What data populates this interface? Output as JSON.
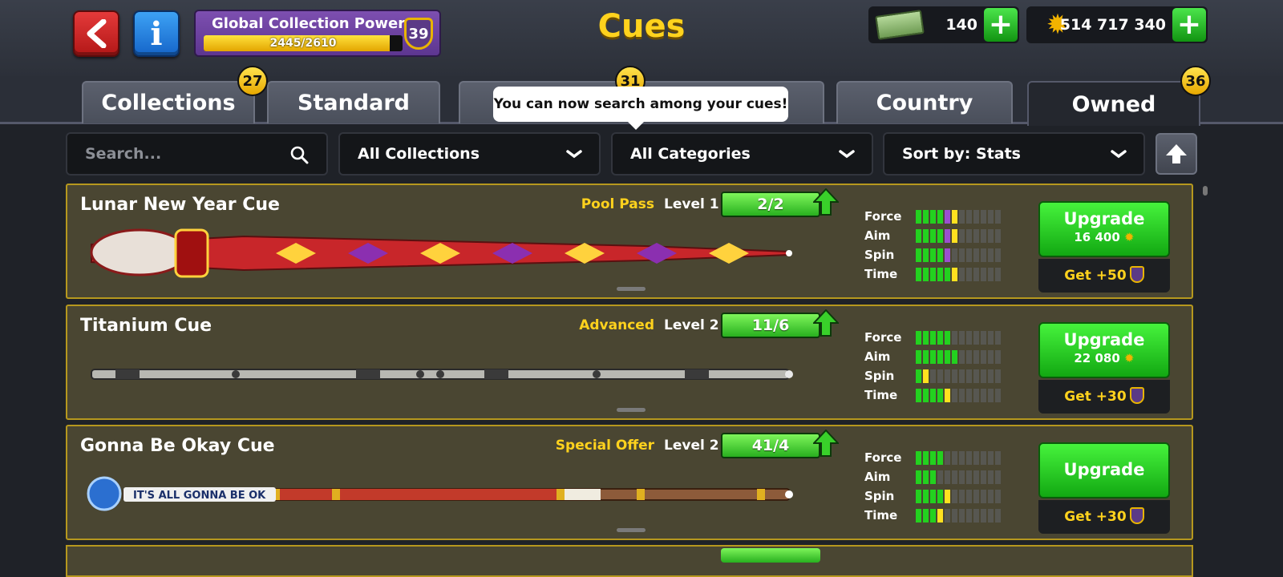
{
  "header": {
    "title": "Cues",
    "global_power": {
      "label": "Global Collection Power",
      "progress_text": "2445/2610",
      "progress_fraction": 0.937,
      "level": "39"
    },
    "cash": "140",
    "coins": "514 717 340"
  },
  "tabs": [
    {
      "label": "Collections",
      "badge": "27"
    },
    {
      "label": "Standard",
      "badge": ""
    },
    {
      "label": "",
      "badge": "31"
    },
    {
      "label": "Country",
      "badge": ""
    },
    {
      "label": "Owned",
      "badge": "36"
    }
  ],
  "tooltip": "You can now search among your cues!",
  "filters": {
    "search_placeholder": "Search...",
    "collections": "All Collections",
    "categories": "All Categories",
    "sort": "Sort by: Stats"
  },
  "stat_labels": [
    "Force",
    "Aim",
    "Spin",
    "Time"
  ],
  "cues": [
    {
      "name": "Lunar New Year Cue",
      "category": "Pool Pass",
      "level": "Level 1",
      "pieces": "2/2",
      "stats": [
        {
          "green": 4,
          "purple": 1,
          "yellow": 1
        },
        {
          "green": 4,
          "purple": 1,
          "yellow": 1
        },
        {
          "green": 4,
          "purple": 1,
          "yellow": 0
        },
        {
          "green": 5,
          "purple": 0,
          "yellow": 1
        }
      ],
      "upgrade_label": "Upgrade",
      "upgrade_price": "16 400",
      "get_label": "Get +50",
      "colors": {
        "main": "#c8262a",
        "accent": "#ffd23d",
        "tip": "#8b2fb0"
      }
    },
    {
      "name": "Titanium Cue",
      "category": "Advanced",
      "level": "Level 2",
      "pieces": "11/6",
      "stats": [
        {
          "green": 5,
          "purple": 0,
          "yellow": 0
        },
        {
          "green": 6,
          "purple": 0,
          "yellow": 0
        },
        {
          "green": 1,
          "purple": 0,
          "yellow": 1
        },
        {
          "green": 4,
          "purple": 0,
          "yellow": 1
        }
      ],
      "upgrade_label": "Upgrade",
      "upgrade_price": "22 080",
      "get_label": "Get +30",
      "colors": {
        "main": "#b8b8b2",
        "accent": "#3a3a3a",
        "tip": "#e8e8e8"
      }
    },
    {
      "name": "Gonna Be Okay Cue",
      "category": "Special Offer",
      "level": "Level 2",
      "pieces": "41/4",
      "stats": [
        {
          "green": 4,
          "purple": 0,
          "yellow": 0
        },
        {
          "green": 3,
          "purple": 0,
          "yellow": 0
        },
        {
          "green": 4,
          "purple": 0,
          "yellow": 1
        },
        {
          "green": 3,
          "purple": 0,
          "yellow": 1
        }
      ],
      "upgrade_label": "Upgrade",
      "upgrade_price": "",
      "get_label": "Get +30",
      "butt_text": "IT'S ALL GONNA BE OK",
      "colors": {
        "main": "#c23a2a",
        "accent": "#8d5b3a",
        "tip": "#ffffff"
      }
    }
  ]
}
